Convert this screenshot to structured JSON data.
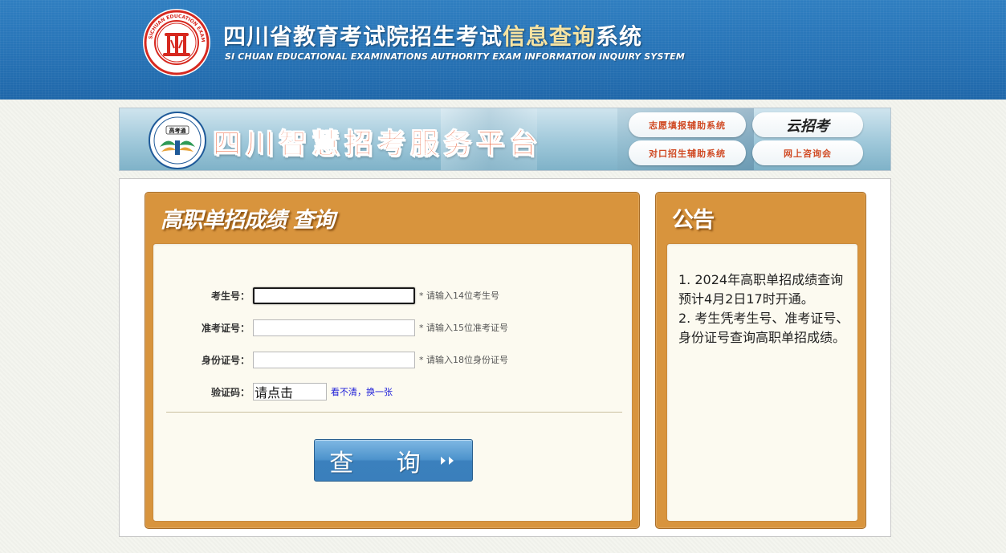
{
  "header": {
    "title_main": "四川省教育考试院招生考试",
    "title_highlight": "信息查询",
    "title_end": "系统",
    "subtitle": "SI CHUAN EDUCATIONAL EXAMINATIONS AUTHORITY EXAM INFORMATION INQUIRY SYSTEM",
    "logo_icon": "sichuan-education-exam-seal"
  },
  "banner": {
    "title": "四川智慧招考服务平台",
    "logo_icon": "gaokaotong-logo",
    "links": {
      "zhiyuan": "志愿填报辅助系统",
      "duikou": "对口招生辅助系统",
      "yunzhaokao": "云招考",
      "zixunhui": "网上咨询会"
    }
  },
  "query_panel": {
    "title": "高职单招成绩 查询",
    "fields": {
      "ksh": {
        "label": "考生号：",
        "value": "",
        "hint": "* 请输入14位考生号"
      },
      "zkzh": {
        "label": "准考证号：",
        "value": "",
        "hint": "* 请输入15位准考证号"
      },
      "sfzh": {
        "label": "身份证号：",
        "value": "",
        "hint": "* 请输入18位身份证号"
      },
      "yzm": {
        "label": "验证码：",
        "value": "请点击",
        "refresh_link": "看不清，换一张"
      }
    },
    "submit_label": "查 询",
    "submit_icon": "double-chevron-right-icon"
  },
  "notice_panel": {
    "title": "公告",
    "items": [
      "1. 2024年高职单招成绩查询预计4月2日17时开通。",
      "2. 考生凭考生号、准考证号、身份证号查询高职单招成绩。"
    ]
  },
  "colors": {
    "header_blue": "#2875b8",
    "panel_orange": "#d8943d",
    "panel_body": "#fcfaf0",
    "highlight_gold": "#f6e3a2",
    "banner_title": "#e8542a",
    "button_blue": "#3b80bd"
  }
}
